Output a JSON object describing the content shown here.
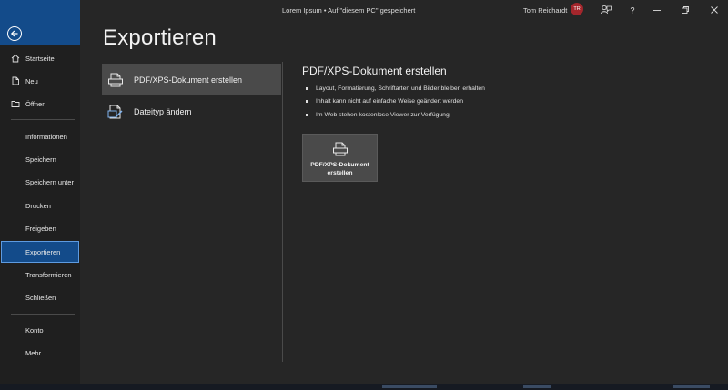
{
  "window": {
    "doc_title": "Lorem Ipsum • Auf \"diesem PC\" gespeichert",
    "user_name": "Tom Reichardt",
    "user_initials": "TR"
  },
  "sidebar": {
    "items": [
      {
        "label": "Startseite",
        "icon": "home-icon"
      },
      {
        "label": "Neu",
        "icon": "new-document-icon"
      },
      {
        "label": "Öffnen",
        "icon": "folder-icon"
      },
      {
        "label": "Informationen"
      },
      {
        "label": "Speichern"
      },
      {
        "label": "Speichern unter"
      },
      {
        "label": "Drucken"
      },
      {
        "label": "Freigeben"
      },
      {
        "label": "Exportieren",
        "active": true
      },
      {
        "label": "Transformieren"
      },
      {
        "label": "Schließen"
      },
      {
        "label": "Konto"
      },
      {
        "label": "Mehr..."
      }
    ]
  },
  "main": {
    "title": "Exportieren",
    "options": [
      {
        "label": "PDF/XPS-Dokument erstellen",
        "icon": "pdf-document-icon",
        "selected": true
      },
      {
        "label": "Dateityp ändern",
        "icon": "change-filetype-icon"
      }
    ],
    "detail": {
      "title": "PDF/XPS-Dokument erstellen",
      "bullets": [
        "Layout, Formatierung, Schriftarten und Bilder bleiben erhalten",
        "Inhalt kann nicht auf einfache Weise geändert werden",
        "Im Web stehen kostenlose Viewer zur Verfügung"
      ],
      "button_label": "PDF/XPS-Dokument erstellen"
    }
  },
  "colors": {
    "accent": "#134b8a",
    "background": "#262626",
    "sidebar": "#1f1f1f"
  }
}
